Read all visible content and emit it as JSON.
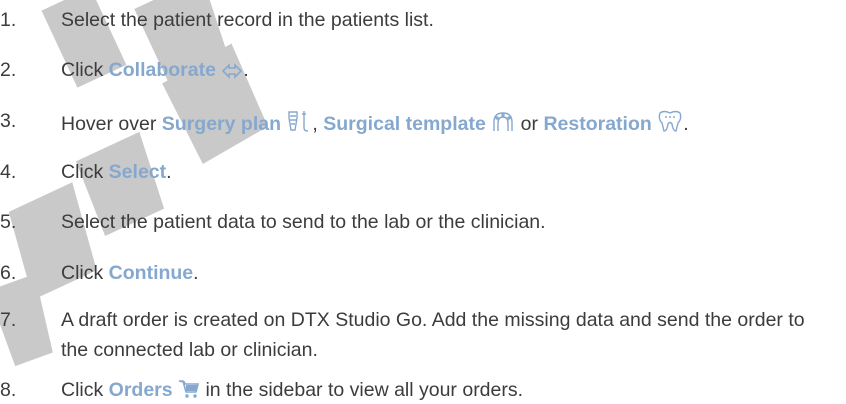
{
  "steps": [
    {
      "number": "1.",
      "text": "Select the patient record in the patients list."
    },
    {
      "number": "2.",
      "pre": "Click ",
      "keyword": "Collaborate",
      "icon": "collaborate-arrows-icon",
      "post": "."
    },
    {
      "number": "3.",
      "pre": "Hover over ",
      "kw1": "Surgery plan",
      "icon1": "surgery-plan-icon",
      "sep1": ", ",
      "kw2": "Surgical template",
      "icon2": "surgical-template-icon",
      "sep2": " or ",
      "kw3": "Restoration",
      "icon3": "restoration-tooth-icon",
      "post": "."
    },
    {
      "number": "4.",
      "pre": "Click ",
      "keyword": "Select",
      "post": "."
    },
    {
      "number": "5.",
      "text": "Select the patient data to send to the lab or the clinician."
    },
    {
      "number": "6.",
      "pre": "Click ",
      "keyword": "Continue",
      "post": "."
    },
    {
      "number": "7.",
      "text": "A draft order is created on DTX Studio Go. Add the missing data and send the order to the connected lab or clinician."
    },
    {
      "number": "8.",
      "pre": "Click ",
      "keyword": "Orders",
      "icon": "cart-icon",
      "post": " in the sidebar to view all your orders."
    }
  ],
  "colors": {
    "text": "#3c3c3c",
    "keyword": "#86a8cf",
    "watermark": "#c8c8c8"
  }
}
